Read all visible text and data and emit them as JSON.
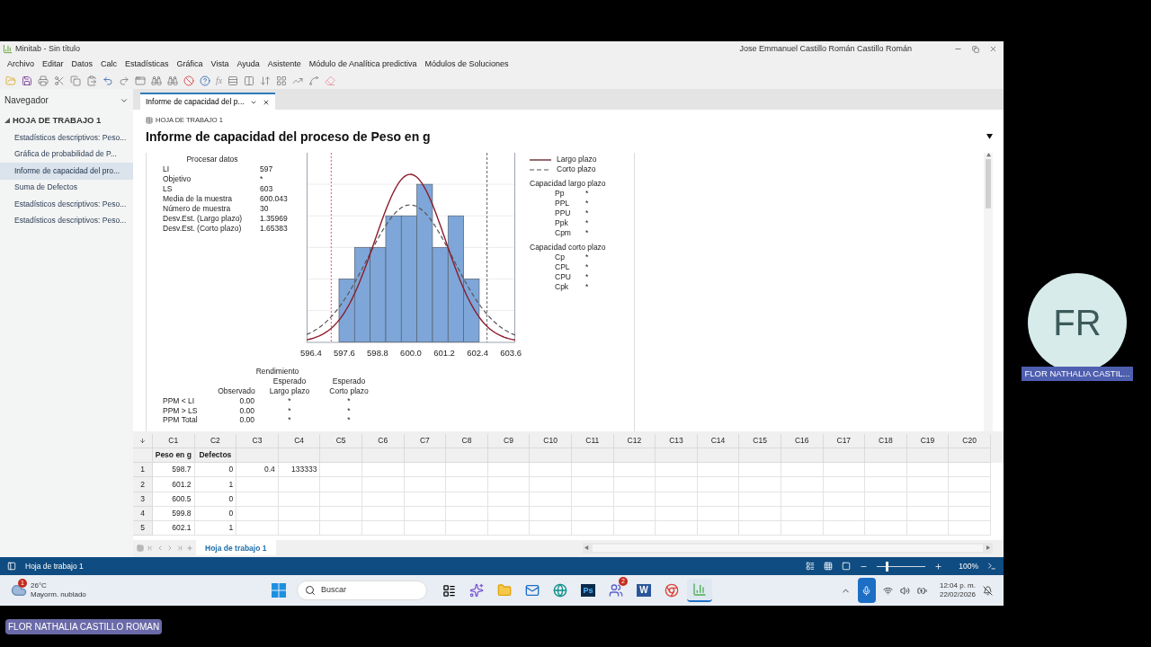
{
  "meeting": {
    "participant_initials": "FR",
    "participant_name": "FLOR NATHALIA CASTIL...",
    "presenter_name": "FLOR NATHALIA CASTILLO ROMAN"
  },
  "window": {
    "title": "Minitab - Sin título",
    "user": "Jose Emmanuel Castillo Román Castillo Román"
  },
  "menu": [
    "Archivo",
    "Editar",
    "Datos",
    "Calc",
    "Estadísticas",
    "Gráfica",
    "Vista",
    "Ayuda",
    "Asistente",
    "Módulo de Analítica predictiva",
    "Módulos de Soluciones"
  ],
  "toolbar": {
    "formula_label": "fx"
  },
  "navigator": {
    "title": "Navegador",
    "group": "HOJA DE TRABAJO 1",
    "expanded": true,
    "items": [
      {
        "label": "Estadísticos descriptivos: Peso...",
        "selected": false
      },
      {
        "label": "Gráfica de probabilidad de P...",
        "selected": false
      },
      {
        "label": "Informe de capacidad del pro...",
        "selected": true
      },
      {
        "label": "Suma de Defectos",
        "selected": false
      },
      {
        "label": "Estadísticos descriptivos: Peso...",
        "selected": false
      },
      {
        "label": "Estadísticos descriptivos: Peso...",
        "selected": false
      }
    ]
  },
  "report_tab": {
    "label": "Informe de capacidad del p...",
    "selected": true
  },
  "report": {
    "breadcrumb": "HOJA DE TRABAJO 1",
    "title": "Informe de capacidad del proceso de Peso en g",
    "process_data": {
      "title": "Procesar datos",
      "rows": [
        {
          "label": "LI",
          "value": "597"
        },
        {
          "label": "Objetivo",
          "value": "*"
        },
        {
          "label": "LS",
          "value": "603"
        },
        {
          "label": "Media de la muestra",
          "value": "600.043"
        },
        {
          "label": "Número de muestra",
          "value": "30"
        },
        {
          "label": "Desv.Est. (Largo plazo)",
          "value": "1.35969"
        },
        {
          "label": "Desv.Est. (Corto plazo)",
          "value": "1.65383"
        }
      ]
    },
    "x_tick_labels": [
      "596.4",
      "597.6",
      "598.8",
      "600.0",
      "601.2",
      "602.4",
      "603.6"
    ],
    "legend": [
      {
        "label": "Largo plazo",
        "kind": "solid"
      },
      {
        "label": "Corto plazo",
        "kind": "dashed"
      }
    ],
    "capability_groups": [
      {
        "title": "Capacidad largo plazo",
        "rows": [
          {
            "label": "Pp",
            "value": "*"
          },
          {
            "label": "PPL",
            "value": "*"
          },
          {
            "label": "PPU",
            "value": "*"
          },
          {
            "label": "Ppk",
            "value": "*"
          },
          {
            "label": "Cpm",
            "value": "*"
          }
        ]
      },
      {
        "title": "Capacidad corto plazo",
        "rows": [
          {
            "label": "Cp",
            "value": "*"
          },
          {
            "label": "CPL",
            "value": "*"
          },
          {
            "label": "CPU",
            "value": "*"
          },
          {
            "label": "Cpk",
            "value": "*"
          }
        ]
      }
    ],
    "performance": {
      "title": "Rendimiento",
      "columns": [
        {
          "bottom": "Observado"
        },
        {
          "top": "Esperado",
          "bottom": "Largo plazo"
        },
        {
          "top": "Esperado",
          "bottom": "Corto plazo"
        }
      ],
      "rows": [
        {
          "label": "PPM < LI",
          "values": [
            "0.00",
            "*",
            "*"
          ]
        },
        {
          "label": "PPM > LS",
          "values": [
            "0.00",
            "*",
            "*"
          ]
        },
        {
          "label": "PPM Total",
          "values": [
            "0.00",
            "*",
            "*"
          ]
        }
      ]
    }
  },
  "worksheet": {
    "columns": [
      "C1",
      "C2",
      "C3",
      "C4",
      "C5",
      "C6",
      "C7",
      "C8",
      "C9",
      "C10",
      "C11",
      "C12",
      "C13",
      "C14",
      "C15",
      "C16",
      "C17",
      "C18",
      "C19",
      "C20"
    ],
    "column_names": [
      "Peso en g",
      "Defectos"
    ],
    "rows": [
      {
        "number": "1",
        "cells": [
          "598.7",
          "0",
          "0.4",
          "133333"
        ]
      },
      {
        "number": "2",
        "cells": [
          "601.2",
          "1"
        ]
      },
      {
        "number": "3",
        "cells": [
          "600.5",
          "0"
        ]
      },
      {
        "number": "4",
        "cells": [
          "599.8",
          "0"
        ]
      },
      {
        "number": "5",
        "cells": [
          "602.1",
          "1"
        ]
      }
    ],
    "sheet_tabs": [
      {
        "label": "Hoja de trabajo 1",
        "selected": true
      }
    ]
  },
  "status_bar": {
    "sheet": "Hoja de trabajo 1",
    "zoom": "100%",
    "zoom_slider": {
      "level": 0.2
    }
  },
  "taskbar": {
    "weather": {
      "temperature": "26°C",
      "condition": "Mayorm. nublado",
      "badge": "1"
    },
    "search_placeholder": "Buscar",
    "apps": [
      {
        "kind": "taskview"
      },
      {
        "kind": "copilot"
      },
      {
        "kind": "folder"
      },
      {
        "kind": "mail"
      },
      {
        "kind": "edge"
      },
      {
        "kind": "photoshop",
        "label": "Ps"
      },
      {
        "kind": "teams",
        "badge": "2"
      },
      {
        "kind": "word",
        "label": "W"
      },
      {
        "kind": "chrome"
      },
      {
        "kind": "minitab",
        "selected": true
      }
    ],
    "time": "12:04 p. m.",
    "date": "22/02/2026"
  }
}
